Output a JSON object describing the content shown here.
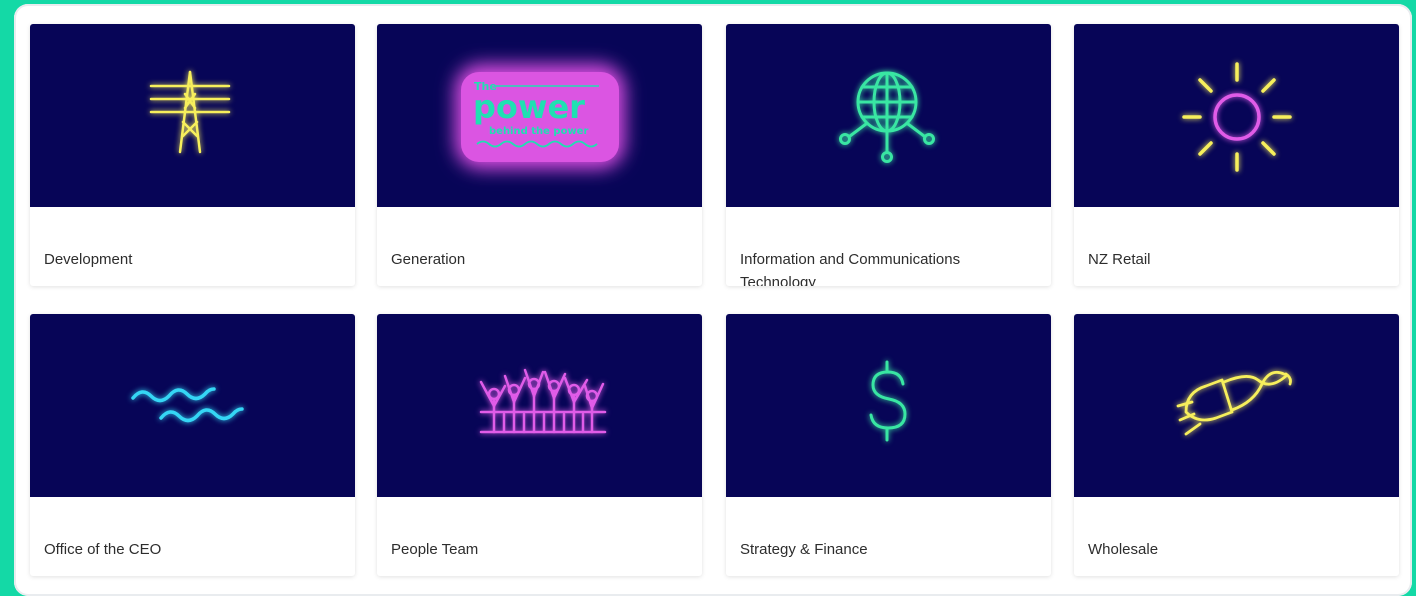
{
  "tiles": [
    {
      "label": "Development",
      "icon": "power-pylon-icon"
    },
    {
      "label": "Generation",
      "icon": "power-behind-the-power-logo",
      "logo": {
        "the": "The",
        "power": "power",
        "tagline": "behind the power"
      }
    },
    {
      "label": "Information and Communications Technology",
      "icon": "globe-network-icon"
    },
    {
      "label": "NZ Retail",
      "icon": "sun-icon"
    },
    {
      "label": "Office of the CEO",
      "icon": "waves-icon"
    },
    {
      "label": "People Team",
      "icon": "people-crowd-icon"
    },
    {
      "label": "Strategy & Finance",
      "icon": "dollar-sign-icon"
    },
    {
      "label": "Wholesale",
      "icon": "power-plug-icon"
    }
  ],
  "colors": {
    "background": "#14d9a6",
    "tile_image_bg": "#070557",
    "neon_yellow": "#f7ef5c",
    "neon_green": "#39e6a3",
    "neon_cyan": "#35d6f5",
    "neon_pink": "#e05ce8",
    "label_text": "#2d2d2d"
  }
}
